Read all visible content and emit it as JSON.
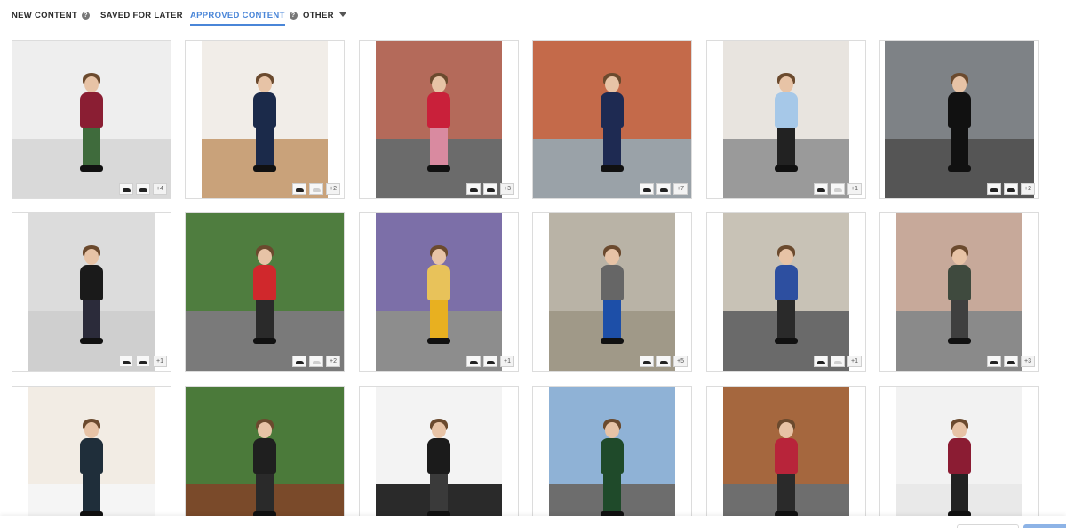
{
  "tabs": [
    {
      "label": "NEW CONTENT",
      "has_help": true
    },
    {
      "label": "SAVED FOR LATER"
    },
    {
      "label": "APPROVED CONTENT",
      "has_help": true,
      "active": true
    },
    {
      "label": "OTHER",
      "has_caret": true
    }
  ],
  "help_glyph": "?",
  "accent_color": "#4a86d8",
  "cards": [
    {
      "extra": "+4",
      "wall": "#eeeeee",
      "floor": "#d9d9d9",
      "kid": [
        "#8a1e33",
        "#3f6b3c"
      ],
      "product_thumbs": 2
    },
    {
      "extra": "+2",
      "wall": "#f1ede8",
      "floor": "#c9a27a",
      "kid": [
        "#1b2a4a",
        "#1b2a4a"
      ],
      "product_thumbs": 2
    },
    {
      "extra": "+3",
      "wall": "#b46a5a",
      "floor": "#6b6b6b",
      "kid": [
        "#c9203a",
        "#d98aa0"
      ],
      "product_thumbs": 2
    },
    {
      "extra": "+7",
      "wall": "#c46a4a",
      "floor": "#9aa2a8",
      "kid": [
        "#1e2a52",
        "#1e2a52"
      ],
      "product_thumbs": 2
    },
    {
      "extra": "+1",
      "wall": "#e8e4df",
      "floor": "#9a9a9a",
      "kid": [
        "#a6c8e8",
        "#222222"
      ],
      "product_thumbs": 2
    },
    {
      "extra": "+2",
      "wall": "#7e8286",
      "floor": "#555555",
      "kid": [
        "#111111",
        "#111111"
      ],
      "product_thumbs": 2
    },
    {
      "extra": "+1",
      "wall": "#dcdcdc",
      "floor": "#cfcfcf",
      "kid": [
        "#1a1a1a",
        "#2b2b3a"
      ],
      "product_thumbs": 2
    },
    {
      "extra": "+2",
      "wall": "#4f7d3f",
      "floor": "#7a7a7a",
      "kid": [
        "#d0282c",
        "#2a2a2a"
      ],
      "product_thumbs": 2
    },
    {
      "extra": "+1",
      "wall": "#7c6fa8",
      "floor": "#8d8d8d",
      "kid": [
        "#e8c25a",
        "#e8b020"
      ],
      "product_thumbs": 2
    },
    {
      "extra": "+5",
      "wall": "#b9b3a6",
      "floor": "#a09988",
      "kid": [
        "#666666",
        "#1d4fa8"
      ],
      "product_thumbs": 2
    },
    {
      "extra": "+1",
      "wall": "#c8c2b6",
      "floor": "#6a6a6a",
      "kid": [
        "#2d4fa0",
        "#2a2a2a"
      ],
      "product_thumbs": 2
    },
    {
      "extra": "+3",
      "wall": "#c7a99a",
      "floor": "#8a8a8a",
      "kid": [
        "#3f4a3e",
        "#3f3f3f"
      ],
      "product_thumbs": 2
    },
    {
      "extra": "",
      "wall": "#f2ece4",
      "floor": "#f5f5f5",
      "kid": [
        "#1f2e3a",
        "#1f2e3a"
      ],
      "product_thumbs": 0
    },
    {
      "extra": "",
      "wall": "#4b7a3a",
      "floor": "#7a4a2a",
      "kid": [
        "#1f1f1f",
        "#2a2a2a"
      ],
      "product_thumbs": 0
    },
    {
      "extra": "",
      "wall": "#f3f3f3",
      "floor": "#2a2a2a",
      "kid": [
        "#1b1b1b",
        "#3a3a3a"
      ],
      "product_thumbs": 0
    },
    {
      "extra": "",
      "wall": "#8fb2d6",
      "floor": "#6d6d6d",
      "kid": [
        "#1f4a2a",
        "#1f4a2a"
      ],
      "product_thumbs": 0
    },
    {
      "extra": "",
      "wall": "#a5673e",
      "floor": "#6e6e6e",
      "kid": [
        "#b8243a",
        "#2a2a2a"
      ],
      "product_thumbs": 0
    },
    {
      "extra": "",
      "wall": "#f2f2f2",
      "floor": "#e9e9e9",
      "kid": [
        "#8b1c33",
        "#222222"
      ],
      "product_thumbs": 0
    }
  ]
}
